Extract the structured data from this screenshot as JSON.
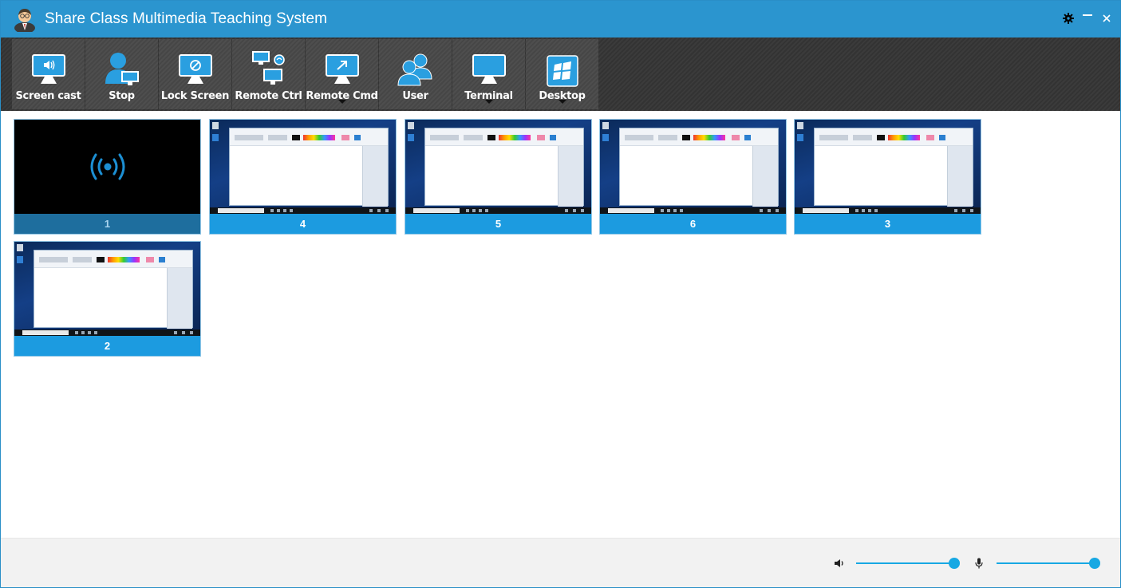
{
  "window": {
    "title": "Share Class Multimedia Teaching System",
    "accent_color": "#2b95cf",
    "controls": [
      "gear-icon",
      "minimize-icon",
      "close-icon"
    ],
    "minimize_glyph": "—",
    "close_glyph": "×"
  },
  "toolbar": {
    "buttons": [
      {
        "label": "Screen cast",
        "icon": "monitor-speaker-icon",
        "dropdown": false
      },
      {
        "label": "Stop",
        "icon": "user-monitor-icon",
        "dropdown": false
      },
      {
        "label": "Lock Screen",
        "icon": "monitor-lock-icon",
        "dropdown": false
      },
      {
        "label": "Remote Ctrl",
        "icon": "remote-monitors-icon",
        "dropdown": false
      },
      {
        "label": "Remote Cmd",
        "icon": "monitor-arrow-icon",
        "dropdown": true
      },
      {
        "label": "User",
        "icon": "users-icon",
        "dropdown": false
      },
      {
        "label": "Terminal",
        "icon": "monitor-icon",
        "dropdown": true
      },
      {
        "label": "Desktop",
        "icon": "windows-logo-icon",
        "dropdown": true
      }
    ]
  },
  "thumbnails": [
    {
      "label": "1",
      "type": "broadcast",
      "active": true
    },
    {
      "label": "4",
      "type": "desktop",
      "active": false
    },
    {
      "label": "5",
      "type": "desktop",
      "active": false
    },
    {
      "label": "6",
      "type": "desktop",
      "active": false
    },
    {
      "label": "3",
      "type": "desktop",
      "active": false
    },
    {
      "label": "2",
      "type": "desktop",
      "active": false
    }
  ],
  "footer": {
    "speaker_volume": 1.0,
    "microphone_volume": 1.0,
    "speaker_icon": "speaker-icon",
    "microphone_icon": "microphone-icon",
    "slider_color": "#17a8e3"
  }
}
